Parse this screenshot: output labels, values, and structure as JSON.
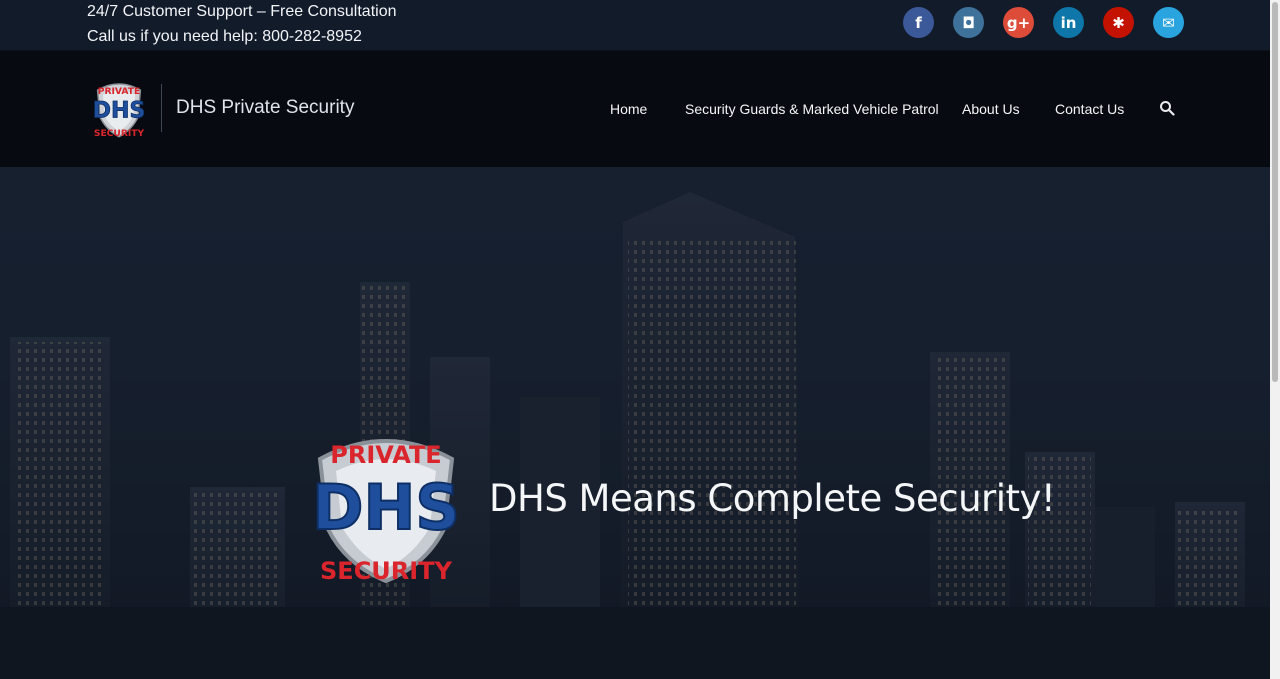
{
  "topbar": {
    "line1": "24/7 Customer Support – Free Consultation",
    "line2": "Call us if you need help: 800-282-8952"
  },
  "social": [
    {
      "name": "facebook-icon",
      "glyph": "f",
      "color": "#3b5998"
    },
    {
      "name": "instagram-icon",
      "glyph": "◘",
      "color": "#3f729b"
    },
    {
      "name": "google-plus-icon",
      "glyph": "g+",
      "color": "#dd4b39"
    },
    {
      "name": "linkedin-icon",
      "glyph": "in",
      "color": "#0e76a8"
    },
    {
      "name": "yelp-icon",
      "glyph": "✱",
      "color": "#c41200"
    },
    {
      "name": "email-icon",
      "glyph": "✉",
      "color": "#2aa4de"
    }
  ],
  "header": {
    "site_title": "DHS Private Security",
    "logo_text": {
      "top": "PRIVATE",
      "middle": "DHS",
      "bottom": "SECURITY"
    }
  },
  "nav": {
    "home": "Home",
    "guards": "Security Guards & Marked Vehicle Patrol",
    "about": "About Us",
    "contact": "Contact Us"
  },
  "hero": {
    "headline": "DHS Means Complete Security!"
  },
  "colors": {
    "topbar_bg": "#121b2a",
    "header_bg": "#070a11",
    "logo_blue": "#1f4f9c",
    "logo_red": "#d9252b"
  }
}
